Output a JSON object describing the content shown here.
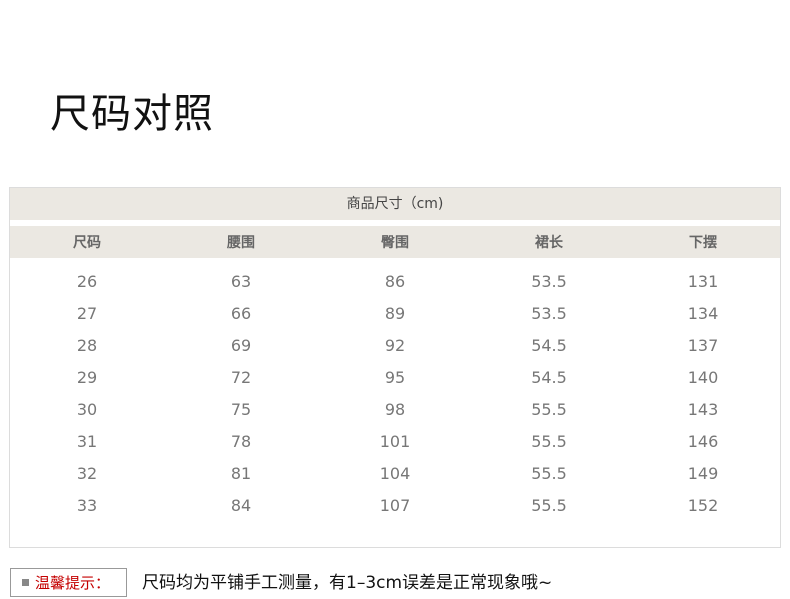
{
  "title": "尺码对照",
  "table": {
    "caption": "商品尺寸（cm)",
    "headers": [
      "尺码",
      "腰围",
      "臀围",
      "裙长",
      "下摆"
    ],
    "rows": [
      [
        "26",
        "63",
        "86",
        "53.5",
        "131"
      ],
      [
        "27",
        "66",
        "89",
        "53.5",
        "134"
      ],
      [
        "28",
        "69",
        "92",
        "54.5",
        "137"
      ],
      [
        "29",
        "72",
        "95",
        "54.5",
        "140"
      ],
      [
        "30",
        "75",
        "98",
        "55.5",
        "143"
      ],
      [
        "31",
        "78",
        "101",
        "55.5",
        "146"
      ],
      [
        "32",
        "81",
        "104",
        "55.5",
        "149"
      ],
      [
        "33",
        "84",
        "107",
        "55.5",
        "152"
      ]
    ]
  },
  "note": {
    "label": "温馨提示：",
    "text": "尺码均为平铺手工测量，有1–3cm误差是正常现象哦~"
  }
}
